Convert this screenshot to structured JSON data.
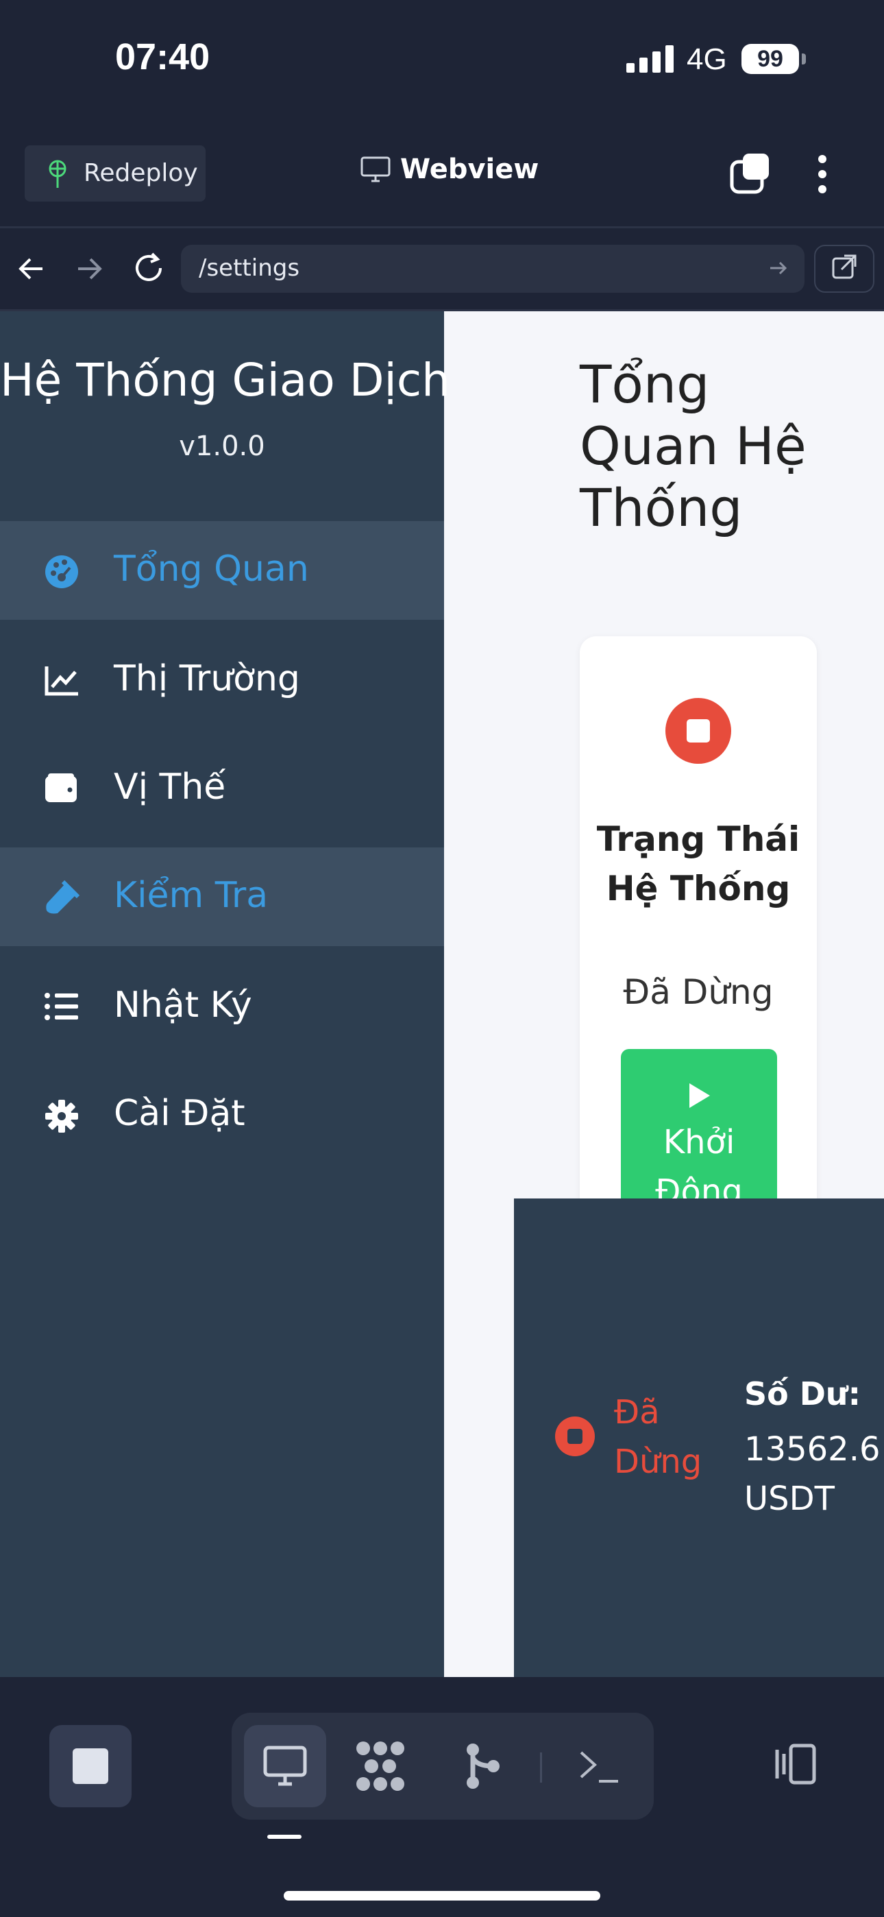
{
  "status_bar": {
    "time": "07:40",
    "network": "4G",
    "battery": "99"
  },
  "header": {
    "redeploy_label": "Redeploy",
    "title": "Webview"
  },
  "url_bar": {
    "path": "/settings"
  },
  "sidebar": {
    "brand": "Hệ Thống Giao Dịch",
    "version": "v1.0.0",
    "items": [
      {
        "label": "Tổng Quan",
        "icon": "dashboard-icon",
        "active": true
      },
      {
        "label": "Thị Trường",
        "icon": "chart-line-icon",
        "active": false
      },
      {
        "label": "Vị Thế",
        "icon": "wallet-icon",
        "active": false
      },
      {
        "label": "Kiểm Tra",
        "icon": "flask-icon",
        "active": true
      },
      {
        "label": "Nhật Ký",
        "icon": "list-icon",
        "active": false
      },
      {
        "label": "Cài Đặt",
        "icon": "gear-icon",
        "active": false
      }
    ]
  },
  "main": {
    "title": "Tổng Quan Hệ Thống",
    "status_card": {
      "title": "Trạng Thái Hệ Thống",
      "status": "Đã Dừng",
      "start_label": "Khởi Động"
    }
  },
  "footer_panel": {
    "status": "Đã Dừng",
    "balance_label": "Số Dư:",
    "balance_value": "13562.6",
    "balance_unit": "USDT"
  },
  "colors": {
    "accent": "#3b9be0",
    "danger": "#e74c3c",
    "success": "#2ecc71",
    "sidebar": "#2d3e50"
  }
}
